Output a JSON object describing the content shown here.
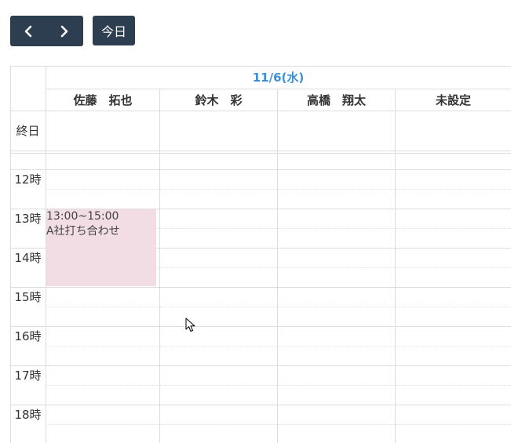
{
  "toolbar": {
    "prev_icon": "chevron-left-icon",
    "next_icon": "chevron-right-icon",
    "today_label": "今日"
  },
  "calendar": {
    "date_header": "11/6(水)",
    "resources": [
      "佐藤　拓也",
      "鈴木　彩",
      "高橋　翔太",
      "未設定"
    ],
    "allday_label": "終日",
    "time_labels": [
      "12時",
      "13時",
      "14時",
      "15時",
      "16時",
      "17時",
      "18時"
    ],
    "events": [
      {
        "time": "13:00~15:00",
        "title": "A社打ち合わせ",
        "resource": "佐藤　拓也"
      }
    ]
  },
  "colors": {
    "button_bg": "#2c3e50",
    "date_header": "#3a8fd6",
    "event_bg": "#f2dde4",
    "grid_line": "#dddddd"
  }
}
